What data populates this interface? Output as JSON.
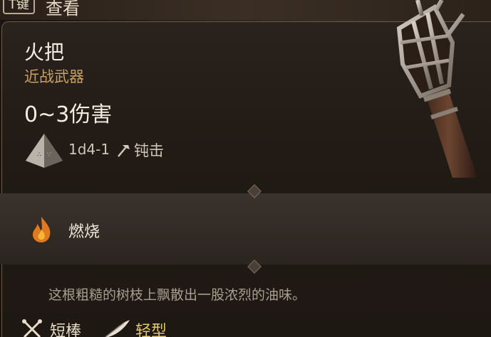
{
  "header": {
    "key_label": "T键",
    "key_action": "查看"
  },
  "item": {
    "name": "火把",
    "type": "近战武器",
    "damage": "0~3伤害",
    "dice_roll": "1d4-1",
    "damage_type": "钝击"
  },
  "properties": [
    {
      "label": "燃烧",
      "icon": "flame-icon",
      "color": "#e07a1c"
    }
  ],
  "description": "这根粗糙的树枝上飘散出一股浓烈的油味。",
  "tags": [
    {
      "label": "短棒",
      "icon": "crossed-clubs-icon",
      "color": "#e8dcc8"
    },
    {
      "label": "轻型",
      "icon": "feather-icon",
      "color": "#e2c86a"
    }
  ],
  "colors": {
    "accent_type": "#c9a063",
    "light_tag": "#e2c86a"
  }
}
